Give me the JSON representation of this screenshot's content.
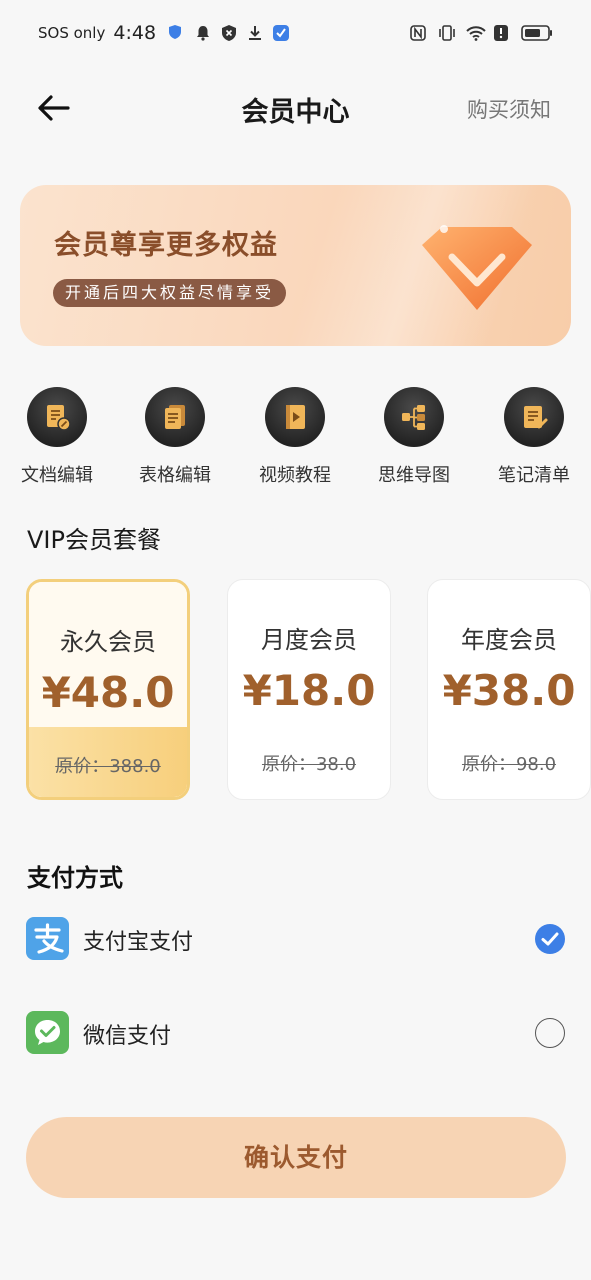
{
  "status_bar": {
    "carrier": "SOS only",
    "time": "4:48"
  },
  "header": {
    "title": "会员中心",
    "right_link": "购买须知"
  },
  "banner": {
    "title": "会员尊享更多权益",
    "subtitle": "开通后四大权益尽情享受"
  },
  "features": [
    {
      "label": "文档编辑",
      "icon": "document-edit-icon"
    },
    {
      "label": "表格编辑",
      "icon": "table-edit-icon"
    },
    {
      "label": "视频教程",
      "icon": "video-tutorial-icon"
    },
    {
      "label": "思维导图",
      "icon": "mind-map-icon"
    },
    {
      "label": "笔记清单",
      "icon": "notes-list-icon"
    }
  ],
  "vip": {
    "section_title": "VIP会员套餐",
    "plans": [
      {
        "name": "永久会员",
        "price": "¥48.0",
        "original": "原价：388.0",
        "selected": true
      },
      {
        "name": "月度会员",
        "price": "¥18.0",
        "original": "原价：38.0",
        "selected": false
      },
      {
        "name": "年度会员",
        "price": "¥38.0",
        "original": "原价：98.0",
        "selected": false
      }
    ]
  },
  "payment": {
    "title": "支付方式",
    "methods": [
      {
        "label": "支付宝支付",
        "icon": "alipay-icon",
        "checked": true
      },
      {
        "label": "微信支付",
        "icon": "wechat-pay-icon",
        "checked": false
      }
    ]
  },
  "confirm_label": "确认支付",
  "colors": {
    "accent_brown": "#a0602c",
    "button_bg": "#f7d4b4",
    "check_blue": "#3d7fe6",
    "alipay_blue": "#4fa3e8",
    "wechat_green": "#5cb85c"
  }
}
